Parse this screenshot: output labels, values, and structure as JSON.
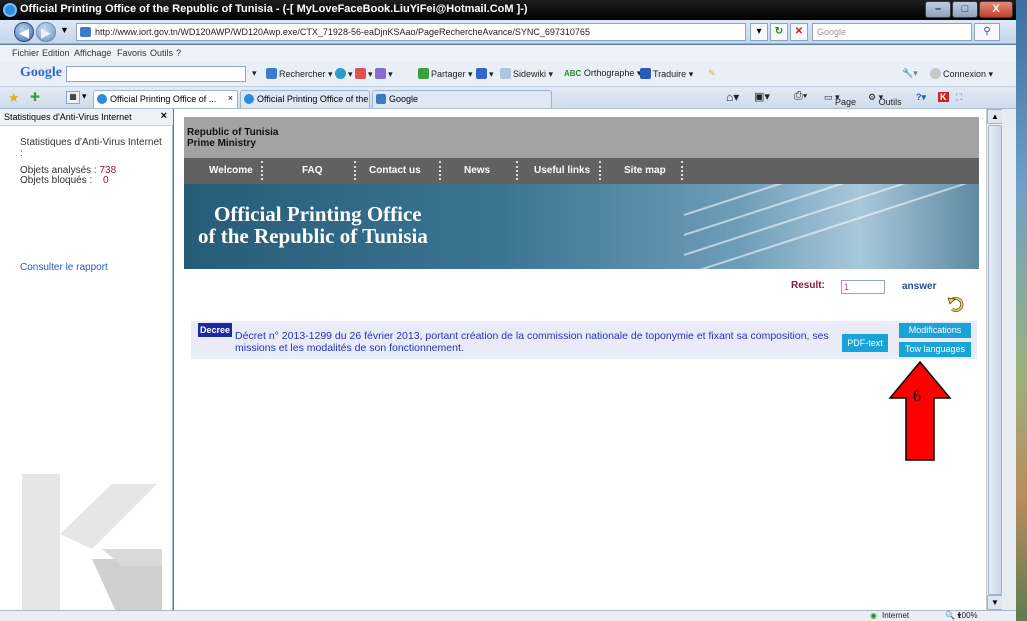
{
  "window": {
    "title": "Official Printing Office of the Republic of Tunisia -  (-[ MyLoveFaceBook.LiuYiFei@Hotmail.CoM ]-)",
    "minimize": "–",
    "maximize": "□",
    "close": "X"
  },
  "address": {
    "url": "http://www.iort.gov.tn/WD120AWP/WD120Awp.exe/CTX_71928-56-eaDjnKSAao/PageRechercheAvance/SYNC_697310765",
    "search_placeholder": "Google"
  },
  "menu": [
    "Fichier",
    "Edition",
    "Affichage",
    "Favoris",
    "Outils",
    "?"
  ],
  "google_toolbar": {
    "logo": "Google",
    "items": [
      "Rechercher",
      "Partager",
      "Sidewiki",
      "Orthographe",
      "Traduire"
    ],
    "connexion": "Connexion"
  },
  "tabs": [
    {
      "label": "Official Printing Office of ...",
      "close": "×"
    },
    {
      "label": "Official Printing Office of the ..."
    },
    {
      "label": "Google"
    }
  ],
  "command_bar": [
    "Page",
    "Outils"
  ],
  "sidebar": {
    "header": "Statistiques d'Anti-Virus Internet",
    "close": "×",
    "title": "Statistiques d'Anti-Virus Internet",
    "analyzed_label": "Objets analysés :",
    "analyzed_value": "738",
    "blocked_label": "Objets bloqués :",
    "blocked_value": "0",
    "report_link": "Consulter le rapport"
  },
  "site": {
    "header_line1": "Republic of Tunisia",
    "header_line2": "Prime Ministry",
    "nav": [
      "Welcome",
      "FAQ",
      "Contact us",
      "News",
      "Useful links",
      "Site map"
    ],
    "banner_line1": "Official Printing Office",
    "banner_line2": "of the Republic of Tunisia",
    "result_label": "Result:",
    "result_value": "1",
    "answer_label": "answer",
    "decree_badge": "Decree",
    "decree_text": "Décret n° 2013-1299 du 26 février 2013, portant création de la commission nationale de toponymie et fixant sa composition, ses missions et les modalités de son fonctionnement.",
    "pdf_button": "PDF-text",
    "modifications_button": "Modifications",
    "two_languages_button": "Tow languages"
  },
  "annotation": {
    "number": "6",
    "arrow_color": "#ff0000"
  },
  "status": {
    "zone": "Internet",
    "zoom": "100%"
  }
}
